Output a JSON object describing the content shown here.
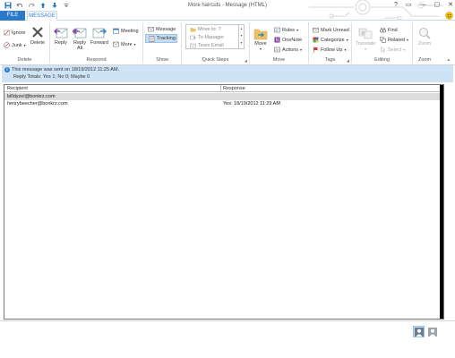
{
  "window": {
    "title": "More haircuts - Message (HTML)",
    "controls": [
      "?",
      "▭",
      "—",
      "▢",
      "✕"
    ]
  },
  "tabs": {
    "file": "FILE",
    "message": "MESSAGE"
  },
  "ribbon": {
    "delete_group": {
      "label": "Delete",
      "ignore": "Ignore",
      "junk": "Junk",
      "delete": "Delete"
    },
    "respond_group": {
      "label": "Respond",
      "reply": "Reply",
      "reply_all_1": "Reply",
      "reply_all_2": "All",
      "forward": "Forward",
      "meeting": "Meeting",
      "more": "More"
    },
    "show_group": {
      "label": "Show",
      "message": "Message",
      "tracking": "Tracking"
    },
    "quick_steps_group": {
      "label": "Quick Steps",
      "items": [
        "Move to: ?",
        "To Manager",
        "Team Email"
      ]
    },
    "move_group": {
      "label": "Move",
      "move": "Move",
      "rules": "Rules",
      "onenote": "OneNote",
      "actions": "Actions"
    },
    "tags_group": {
      "label": "Tags",
      "mark_unread": "Mark Unread",
      "categorize": "Categorize",
      "follow_up": "Follow Up"
    },
    "editing_group": {
      "label": "Editing",
      "translate": "Translate",
      "find": "Find",
      "related": "Related",
      "select": "Select"
    },
    "zoom_group": {
      "label": "Zoom",
      "zoom": "Zoom"
    }
  },
  "infobar": {
    "line1": "This message was sent on 18/19/2012 11:25 AM.",
    "line2": "Reply Totals: Yes 1; No 0; Maybe 0"
  },
  "table": {
    "headers": [
      "Recipient",
      "Response"
    ],
    "rows": [
      {
        "recipient": "billdyzel@bonkrz.com",
        "response": ""
      },
      {
        "recipient": "henrybeecher@bonkrz.com",
        "response": "Yes: 18/19/2012 11:29 AM"
      }
    ]
  },
  "colors": {
    "accent": "#2b79c7",
    "infobar": "#cfe3f6",
    "selected": "#c5dcf3"
  }
}
